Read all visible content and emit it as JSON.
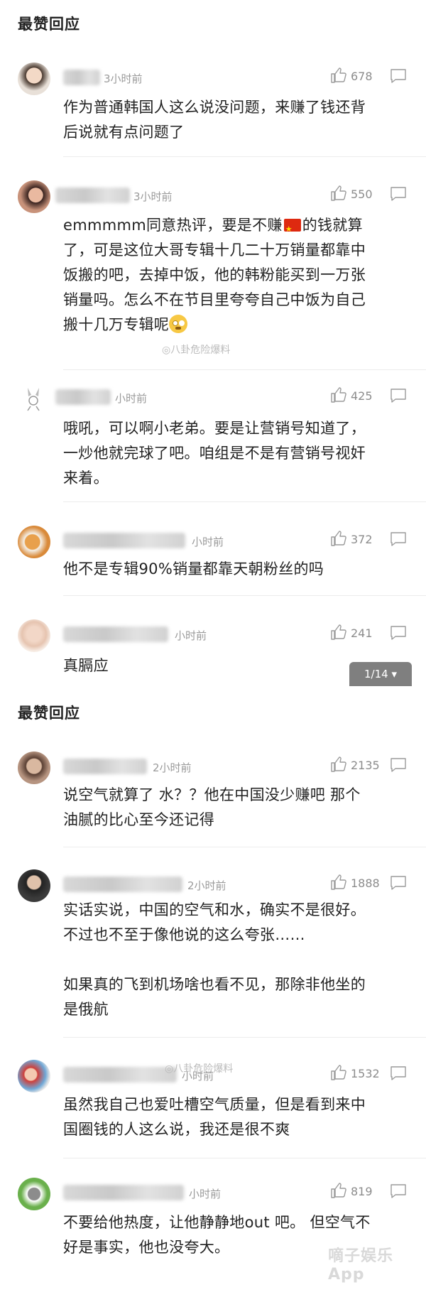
{
  "sections": [
    {
      "title": "最赞回应"
    },
    {
      "title": "最赞回应"
    }
  ],
  "comments": [
    {
      "time": "3小时前",
      "likes": "678",
      "text": "作为普通韩国人这么说没问题，来赚了钱还背\n后说就有点问题了"
    },
    {
      "time": "3小时前",
      "likes": "550",
      "text_parts": [
        "emmmmm同意热评，要是不赚",
        "的钱就算\n了，可是这位大哥专辑十几二十万销量都靠中\n饭搬的吧，去掉中饭，他的韩粉能买到一万张\n销量吗。怎么不在节目里夸夸自己中饭为自己\n搬十几万专辑呢"
      ]
    },
    {
      "time": "小时前",
      "likes": "425",
      "text": "哦吼，可以啊小老弟。要是让营销号知道了，\n一炒他就完球了吧。咱组是不是有营销号视奸\n来着。"
    },
    {
      "time": "小时前",
      "likes": "372",
      "text": "他不是专辑90%销量都靠天朝粉丝的吗"
    },
    {
      "time": "小时前",
      "likes": "241",
      "text": "真膈应"
    },
    {
      "time": "2小时前",
      "likes": "2135",
      "text": "说空气就算了 水？？他在中国没少赚吧 那个\n油腻的比心至今还记得"
    },
    {
      "time": "2小时前",
      "likes": "1888",
      "text": "实话实说，中国的空气和水，确实不是很好。\n不过也不至于像他说的这么夸张……\n\n如果真的飞到机场啥也看不见，那除非他坐的\n是俄航"
    },
    {
      "time": "小时前",
      "likes": "1532",
      "text": "虽然我自己也爱吐槽空气质量，但是看到来中\n国圈钱的人这么说，我还是很不爽"
    },
    {
      "time": "小时前",
      "likes": "819",
      "text": "不要给他热度，让他静静地out 吧。 但空气不\n好是事实，他也没夸大。"
    }
  ],
  "pager": {
    "label": "1/14 ▾"
  },
  "watermarks": {
    "weibo": "八卦危险爆料",
    "brand": "嘀子娱乐App"
  },
  "colors": {
    "text": "#222222",
    "meta": "#9a9a9a",
    "pager_bg": "#7f7f7f"
  },
  "icons": {
    "like": "thumbs-up-icon",
    "reply": "comment-bubble-icon"
  }
}
